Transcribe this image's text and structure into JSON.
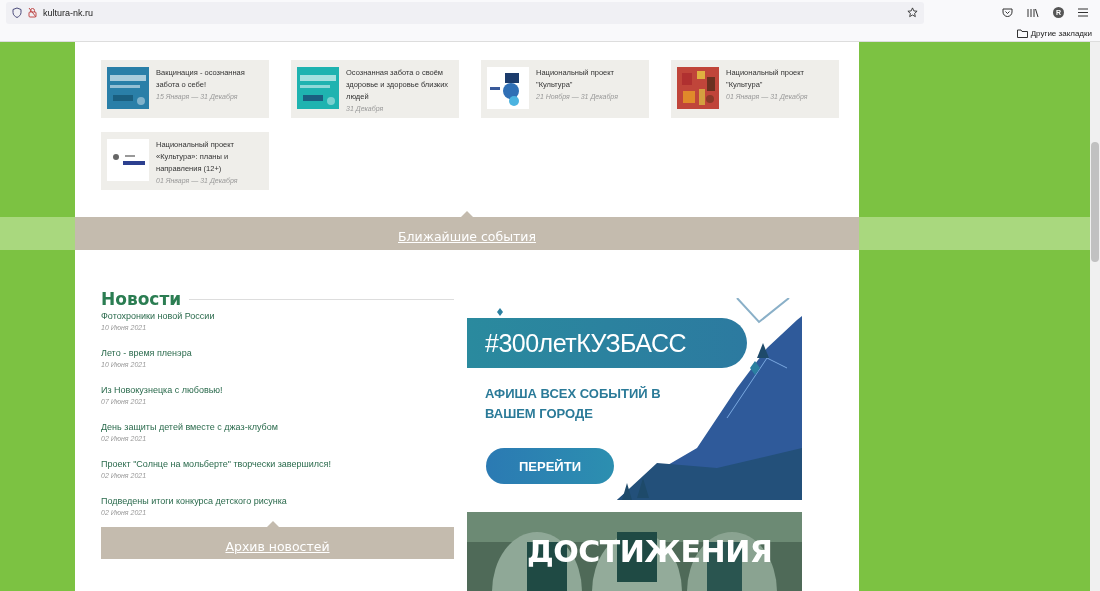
{
  "browser": {
    "url": "kultura-nk.ru",
    "avatar": "R",
    "bookmarks_folder": "Другие закладки"
  },
  "events": [
    {
      "title": "Вакцинация - осознанная забота о себе!",
      "dates": "15 Января — 31 Декабря"
    },
    {
      "title": "Осознанная забота о своём здоровье и здоровье близких людей",
      "dates": "31 Декабря"
    },
    {
      "title": "Национальный проект \"Культура\"",
      "dates": "21 Ноября — 31 Декабря"
    },
    {
      "title": "Национальный проект \"Культура\"",
      "dates": "01 Января — 31 Декабря"
    },
    {
      "title": "Национальный проект «Культура»: планы и направления (12+)",
      "dates": "01 Января — 31 Декабря"
    }
  ],
  "events_link": "Ближайшие события",
  "news": {
    "heading": "Новости",
    "items": [
      {
        "title": "Фотохроники новой России",
        "date": "10 Июня 2021"
      },
      {
        "title": "Лето - время пленэра",
        "date": "10 Июня 2021"
      },
      {
        "title": "Из Новокузнецка с любовью!",
        "date": "07 Июня 2021"
      },
      {
        "title": "День защиты детей вместе с джаз-клубом",
        "date": "02 Июня 2021"
      },
      {
        "title": "Проект \"Солнце на мольберте\" творчески завершился!",
        "date": "02 Июня 2021"
      },
      {
        "title": "Подведены итоги конкурса детского рисунка",
        "date": "02 Июня 2021"
      }
    ],
    "archive_link": "Архив новостей"
  },
  "promo": {
    "logo": "#300летКУЗБАСС",
    "tagline": "АФИША ВСЕХ СОБЫТИЙ В ВАШЕМ ГОРОДЕ",
    "button": "ПЕРЕЙТИ"
  },
  "achievements": {
    "title": "ДОСТИЖЕНИЯ"
  }
}
